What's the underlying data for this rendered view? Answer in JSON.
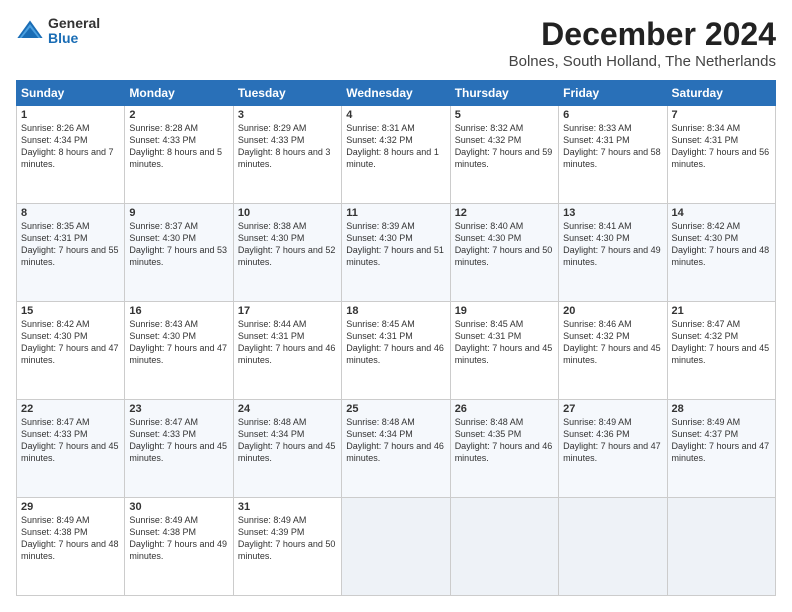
{
  "header": {
    "logo_general": "General",
    "logo_blue": "Blue",
    "month_title": "December 2024",
    "location": "Bolnes, South Holland, The Netherlands"
  },
  "days_of_week": [
    "Sunday",
    "Monday",
    "Tuesday",
    "Wednesday",
    "Thursday",
    "Friday",
    "Saturday"
  ],
  "weeks": [
    [
      {
        "day": "1",
        "sunrise": "8:26 AM",
        "sunset": "4:34 PM",
        "daylight": "8 hours and 7 minutes."
      },
      {
        "day": "2",
        "sunrise": "8:28 AM",
        "sunset": "4:33 PM",
        "daylight": "8 hours and 5 minutes."
      },
      {
        "day": "3",
        "sunrise": "8:29 AM",
        "sunset": "4:33 PM",
        "daylight": "8 hours and 3 minutes."
      },
      {
        "day": "4",
        "sunrise": "8:31 AM",
        "sunset": "4:32 PM",
        "daylight": "8 hours and 1 minute."
      },
      {
        "day": "5",
        "sunrise": "8:32 AM",
        "sunset": "4:32 PM",
        "daylight": "7 hours and 59 minutes."
      },
      {
        "day": "6",
        "sunrise": "8:33 AM",
        "sunset": "4:31 PM",
        "daylight": "7 hours and 58 minutes."
      },
      {
        "day": "7",
        "sunrise": "8:34 AM",
        "sunset": "4:31 PM",
        "daylight": "7 hours and 56 minutes."
      }
    ],
    [
      {
        "day": "8",
        "sunrise": "8:35 AM",
        "sunset": "4:31 PM",
        "daylight": "7 hours and 55 minutes."
      },
      {
        "day": "9",
        "sunrise": "8:37 AM",
        "sunset": "4:30 PM",
        "daylight": "7 hours and 53 minutes."
      },
      {
        "day": "10",
        "sunrise": "8:38 AM",
        "sunset": "4:30 PM",
        "daylight": "7 hours and 52 minutes."
      },
      {
        "day": "11",
        "sunrise": "8:39 AM",
        "sunset": "4:30 PM",
        "daylight": "7 hours and 51 minutes."
      },
      {
        "day": "12",
        "sunrise": "8:40 AM",
        "sunset": "4:30 PM",
        "daylight": "7 hours and 50 minutes."
      },
      {
        "day": "13",
        "sunrise": "8:41 AM",
        "sunset": "4:30 PM",
        "daylight": "7 hours and 49 minutes."
      },
      {
        "day": "14",
        "sunrise": "8:42 AM",
        "sunset": "4:30 PM",
        "daylight": "7 hours and 48 minutes."
      }
    ],
    [
      {
        "day": "15",
        "sunrise": "8:42 AM",
        "sunset": "4:30 PM",
        "daylight": "7 hours and 47 minutes."
      },
      {
        "day": "16",
        "sunrise": "8:43 AM",
        "sunset": "4:30 PM",
        "daylight": "7 hours and 47 minutes."
      },
      {
        "day": "17",
        "sunrise": "8:44 AM",
        "sunset": "4:31 PM",
        "daylight": "7 hours and 46 minutes."
      },
      {
        "day": "18",
        "sunrise": "8:45 AM",
        "sunset": "4:31 PM",
        "daylight": "7 hours and 46 minutes."
      },
      {
        "day": "19",
        "sunrise": "8:45 AM",
        "sunset": "4:31 PM",
        "daylight": "7 hours and 45 minutes."
      },
      {
        "day": "20",
        "sunrise": "8:46 AM",
        "sunset": "4:32 PM",
        "daylight": "7 hours and 45 minutes."
      },
      {
        "day": "21",
        "sunrise": "8:47 AM",
        "sunset": "4:32 PM",
        "daylight": "7 hours and 45 minutes."
      }
    ],
    [
      {
        "day": "22",
        "sunrise": "8:47 AM",
        "sunset": "4:33 PM",
        "daylight": "7 hours and 45 minutes."
      },
      {
        "day": "23",
        "sunrise": "8:47 AM",
        "sunset": "4:33 PM",
        "daylight": "7 hours and 45 minutes."
      },
      {
        "day": "24",
        "sunrise": "8:48 AM",
        "sunset": "4:34 PM",
        "daylight": "7 hours and 45 minutes."
      },
      {
        "day": "25",
        "sunrise": "8:48 AM",
        "sunset": "4:34 PM",
        "daylight": "7 hours and 46 minutes."
      },
      {
        "day": "26",
        "sunrise": "8:48 AM",
        "sunset": "4:35 PM",
        "daylight": "7 hours and 46 minutes."
      },
      {
        "day": "27",
        "sunrise": "8:49 AM",
        "sunset": "4:36 PM",
        "daylight": "7 hours and 47 minutes."
      },
      {
        "day": "28",
        "sunrise": "8:49 AM",
        "sunset": "4:37 PM",
        "daylight": "7 hours and 47 minutes."
      }
    ],
    [
      {
        "day": "29",
        "sunrise": "8:49 AM",
        "sunset": "4:38 PM",
        "daylight": "7 hours and 48 minutes."
      },
      {
        "day": "30",
        "sunrise": "8:49 AM",
        "sunset": "4:38 PM",
        "daylight": "7 hours and 49 minutes."
      },
      {
        "day": "31",
        "sunrise": "8:49 AM",
        "sunset": "4:39 PM",
        "daylight": "7 hours and 50 minutes."
      },
      null,
      null,
      null,
      null
    ]
  ],
  "labels": {
    "sunrise": "Sunrise:",
    "sunset": "Sunset:",
    "daylight": "Daylight:"
  }
}
